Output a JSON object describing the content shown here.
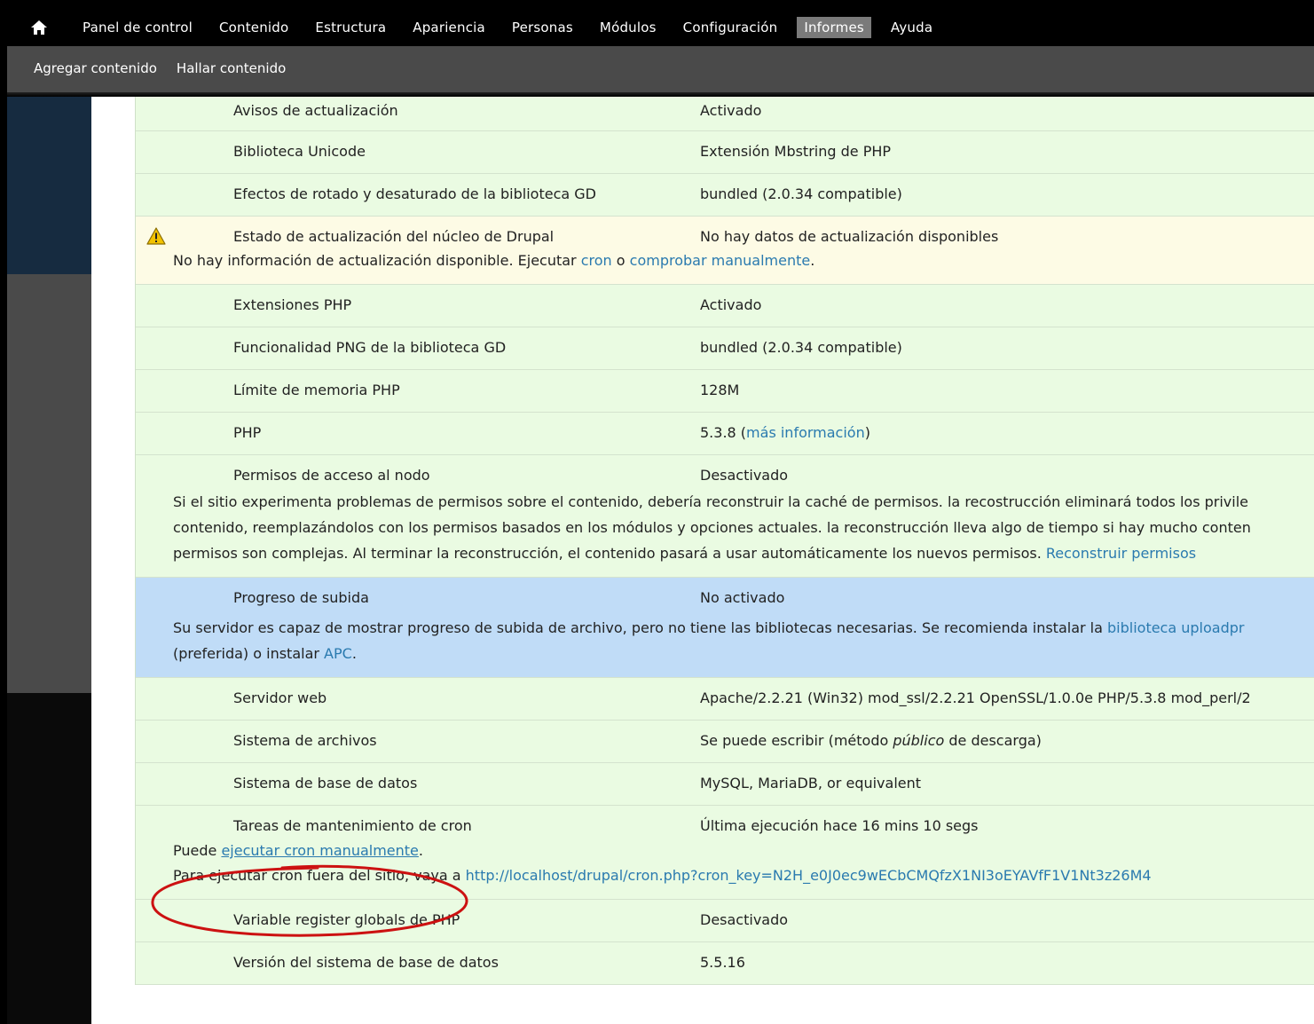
{
  "toolbar": {
    "menu": [
      "Panel de control",
      "Contenido",
      "Estructura",
      "Apariencia",
      "Personas",
      "Módulos",
      "Configuración",
      "Informes",
      "Ayuda"
    ],
    "active_item": "Informes"
  },
  "shortcuts": [
    "Agregar contenido",
    "Hallar contenido"
  ],
  "rows": {
    "avisos": {
      "title": "Avisos de actualización",
      "value": "Activado"
    },
    "unicode": {
      "title": "Biblioteca Unicode",
      "value": "Extensión Mbstring de PHP"
    },
    "gd_efectos": {
      "title": "Efectos de rotado y desaturado de la biblioteca GD",
      "value": "bundled (2.0.34 compatible)"
    },
    "drupal_core": {
      "title": "Estado de actualización del núcleo de Drupal",
      "value": "No hay datos de actualización disponibles",
      "desc_pre": "No hay información de actualización disponible. Ejecutar ",
      "desc_link1": "cron",
      "desc_mid": " o ",
      "desc_link2": "comprobar manualmente",
      "desc_post": "."
    },
    "php_ext": {
      "title": "Extensiones PHP",
      "value": "Activado"
    },
    "gd_png": {
      "title": "Funcionalidad PNG de la biblioteca GD",
      "value": "bundled (2.0.34 compatible)"
    },
    "mem_limit": {
      "title": "Límite de memoria PHP",
      "value": "128M"
    },
    "php": {
      "title": "PHP",
      "value_pre": "5.3.8 (",
      "value_link": "más información",
      "value_post": ")"
    },
    "node_access": {
      "title": "Permisos de acceso al nodo",
      "value": "Desactivado",
      "desc_line1": "Si el sitio experimenta problemas de permisos sobre el contenido, debería reconstruir la caché de permisos. la recostrucción eliminará todos los privile",
      "desc_line2": "contenido, reemplazándolos con los permisos basados en los módulos y opciones actuales. la reconstrucción lleva algo de tiempo si hay mucho conten",
      "desc_line3_pre": "permisos son complejas. Al terminar la reconstrucción, el contenido pasará a usar automáticamente los nuevos permisos. ",
      "desc_line3_link": "Reconstruir permisos"
    },
    "upload_progress": {
      "title": "Progreso de subida",
      "value": "No activado",
      "desc_line1_pre": "Su servidor es capaz de mostrar progreso de subida de archivo, pero no tiene las bibliotecas necesarias. Se recomienda instalar la ",
      "desc_line1_link": "biblioteca uploadpr",
      "desc_line2_pre": "(preferida) o instalar ",
      "desc_line2_link": "APC",
      "desc_line2_post": "."
    },
    "web_server": {
      "title": "Servidor web",
      "value": "Apache/2.2.21 (Win32) mod_ssl/2.2.21 OpenSSL/1.0.0e PHP/5.3.8 mod_perl/2"
    },
    "file_system": {
      "title": "Sistema de archivos",
      "value_pre": "Se puede escribir (método ",
      "value_em": "público",
      "value_post": " de descarga)"
    },
    "database": {
      "title": "Sistema de base de datos",
      "value": "MySQL, MariaDB, or equivalent"
    },
    "cron": {
      "title": "Tareas de mantenimiento de cron",
      "value": "Última ejecución hace 16 mins 10 segs",
      "desc_line1_pre": "Puede ",
      "desc_line1_link": "ejecutar cron manualmente",
      "desc_line1_post": ".",
      "desc_line2_pre": "Para ejecutar cron fuera del sitio, vaya a ",
      "desc_line2_link": "http://localhost/drupal/cron.php?cron_key=N2H_e0J0ec9wECbCMQfzX1NI3oEYAVfF1V1Nt3z26M4"
    },
    "register_globals": {
      "title": "Variable register globals de PHP",
      "value": "Desactivado"
    },
    "db_version": {
      "title": "Versión del sistema de base de datos",
      "value": "5.5.16"
    }
  },
  "colors": {
    "ok_row": "#eafbe2",
    "warning_row": "#fdfbe5",
    "info_row": "#c0dcf7",
    "link": "#2a7aaf",
    "annotation_circle": "#cc1111"
  }
}
